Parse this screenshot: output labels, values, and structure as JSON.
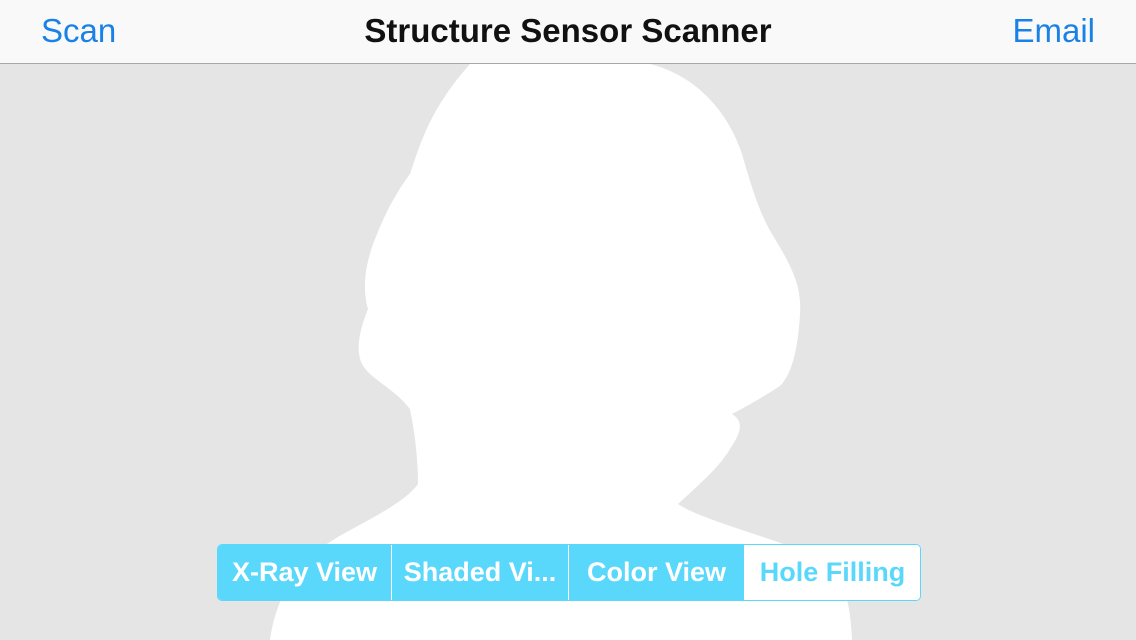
{
  "navbar": {
    "left_button": "Scan",
    "title": "Structure Sensor Scanner",
    "right_button": "Email"
  },
  "view_modes": {
    "items": [
      {
        "label": "X-Ray View",
        "selected": true
      },
      {
        "label": "Shaded Vi...",
        "selected": true
      },
      {
        "label": "Color View",
        "selected": true
      },
      {
        "label": "Hole Filling",
        "selected": false
      }
    ]
  },
  "colors": {
    "accent": "#1a82e6",
    "segment_tint": "#5ad8fb",
    "background": "#e5e5e5",
    "silhouette": "#ffffff"
  }
}
